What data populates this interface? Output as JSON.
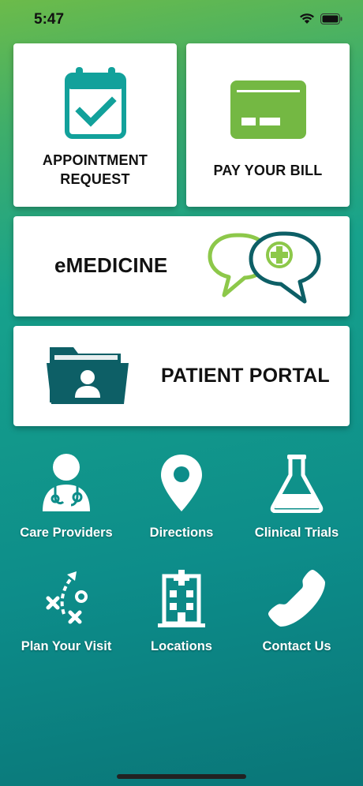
{
  "status_bar": {
    "time": "5:47"
  },
  "cards": {
    "appointment": "APPOINTMENT REQUEST",
    "pay_bill": "PAY YOUR BILL",
    "emedicine": "eMEDICINE",
    "patient_portal": "PATIENT PORTAL"
  },
  "grid": [
    {
      "label": "Care Providers",
      "icon": "doctor-icon"
    },
    {
      "label": "Directions",
      "icon": "map-pin-icon"
    },
    {
      "label": "Clinical Trials",
      "icon": "flask-icon"
    },
    {
      "label": "Plan Your Visit",
      "icon": "strategy-icon"
    },
    {
      "label": "Locations",
      "icon": "hospital-building-icon"
    },
    {
      "label": "Contact Us",
      "icon": "phone-icon"
    }
  ],
  "colors": {
    "teal_dark": "#0d5f66",
    "teal": "#12a19b",
    "green": "#74b843",
    "green_light": "#8dc84a"
  }
}
